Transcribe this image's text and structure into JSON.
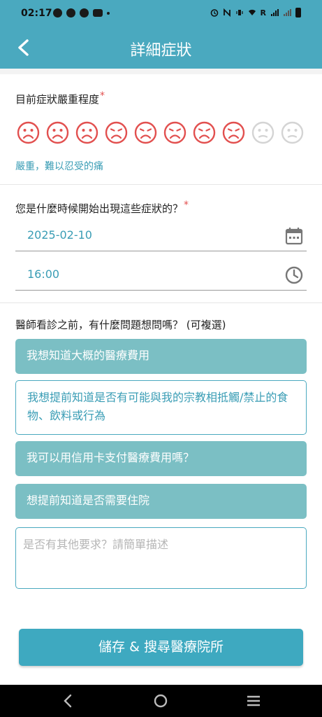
{
  "status_bar": {
    "time": "02:17",
    "right_label": "R"
  },
  "header": {
    "title": "詳細症狀"
  },
  "severity": {
    "label": "目前症狀嚴重程度",
    "required_mark": "*",
    "scale_max": 10,
    "selected_level": 8,
    "active_color": "#e2504f",
    "inactive_color": "#d4d4d4",
    "description": "嚴重，難以忍受的痛"
  },
  "onset": {
    "label": "您是什麼時候開始出現這些症狀的？",
    "required_mark": "*",
    "date": "2025-02-10",
    "time": "16:00"
  },
  "questions": {
    "label": "醫師看診之前，有什麼問題想問嗎？ (可複選)",
    "options": [
      {
        "text": "我想知道大概的醫療費用",
        "selected": true
      },
      {
        "text": "我想提前知道是否有可能與我的宗教相抵觸/禁止的食物、飲料或行為",
        "selected": false
      },
      {
        "text": "我可以用信用卡支付醫療費用嗎？",
        "selected": true
      },
      {
        "text": "想提前知道是否需要住院",
        "selected": true
      }
    ]
  },
  "other_request": {
    "placeholder": "是否有其他要求？請簡單描述"
  },
  "actions": {
    "save_label": "儲存 & 搜尋醫療院所"
  },
  "colors": {
    "primary": "#4aa9bf",
    "selected_option": "#7bbfc4",
    "accent_text": "#3a9db5"
  }
}
